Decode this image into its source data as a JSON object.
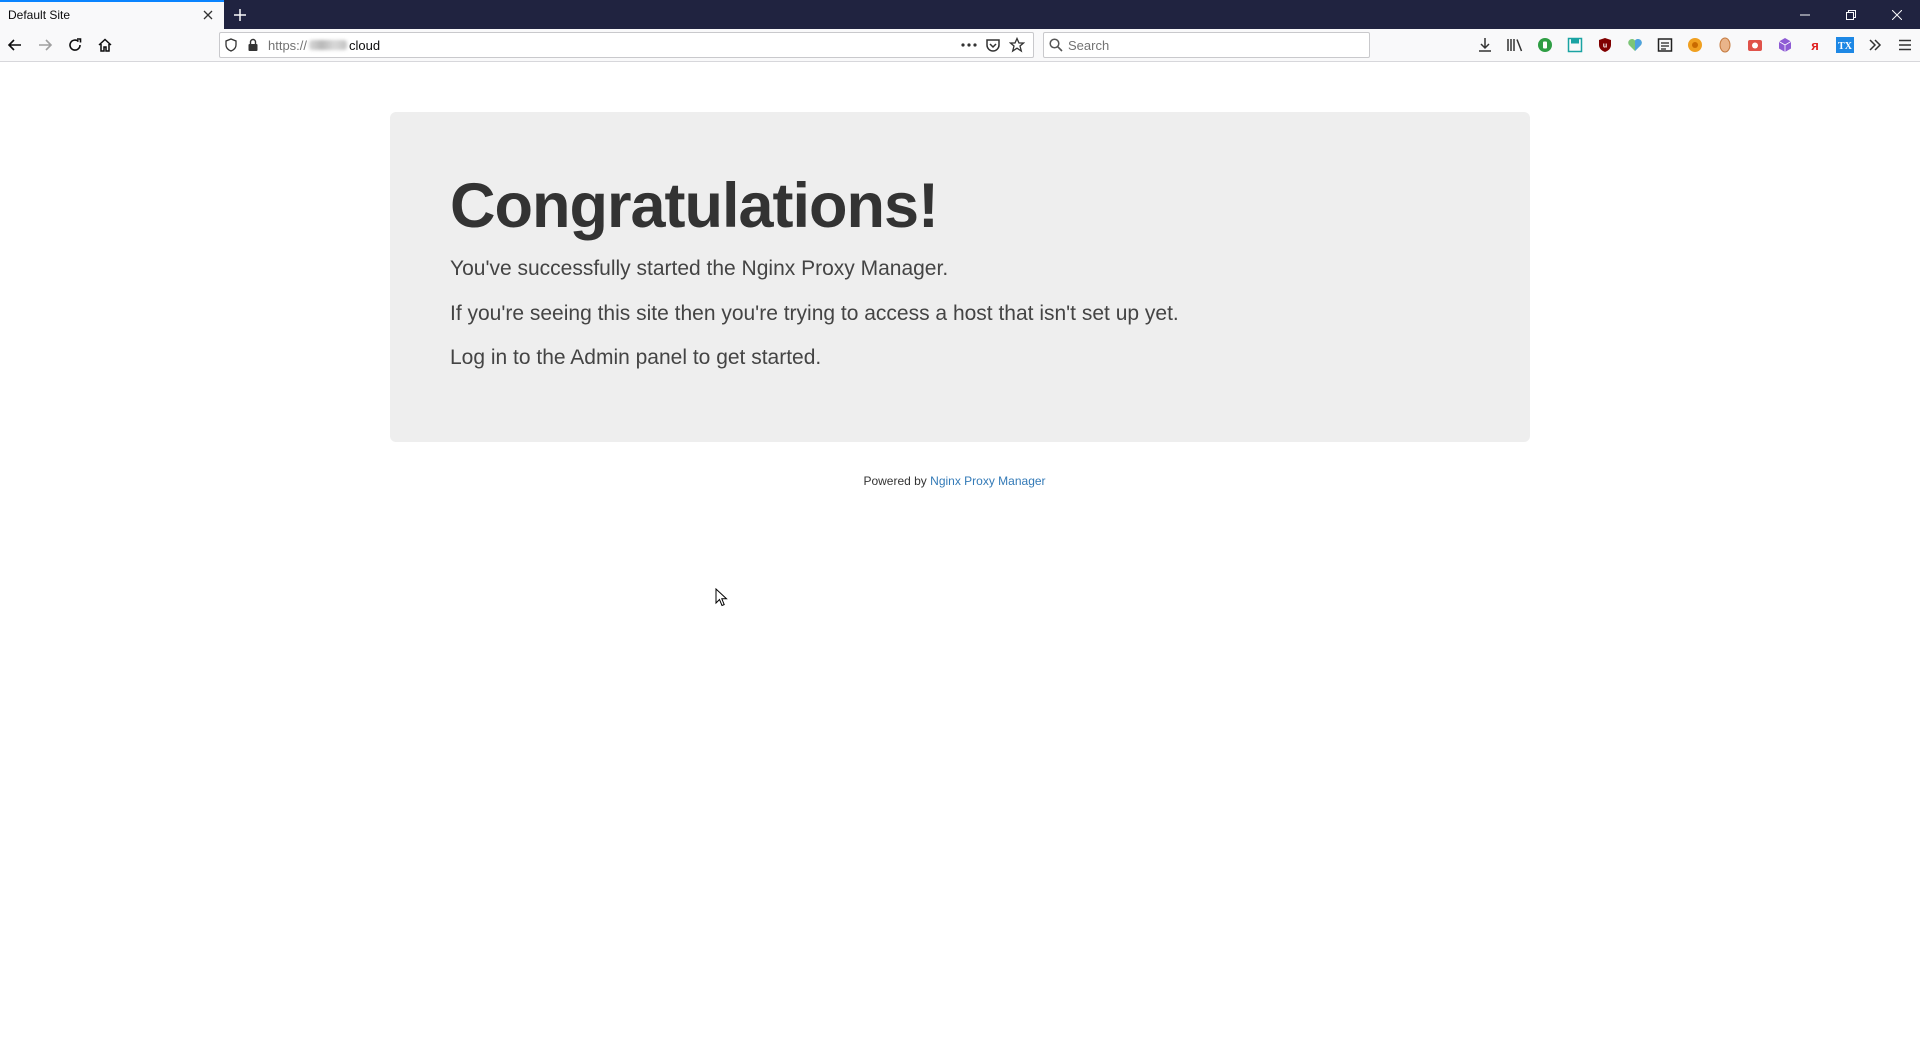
{
  "browser": {
    "tab": {
      "title": "Default Site"
    },
    "url": {
      "protocol": "https://",
      "domain": "cloud"
    },
    "search": {
      "placeholder": "Search"
    }
  },
  "page": {
    "heading": "Congratulations!",
    "paragraphs": [
      "You've successfully started the Nginx Proxy Manager.",
      "If you're seeing this site then you're trying to access a host that isn't set up yet.",
      "Log in to the Admin panel to get started."
    ],
    "footer": {
      "prefix": "Powered by",
      "link_text": "Nginx Proxy Manager"
    }
  },
  "colors": {
    "tabstrip_bg": "#202340",
    "tab_active_accent": "#0a84ff",
    "jumbotron_bg": "#eeeeee",
    "link": "#337ab7"
  },
  "icons": {
    "toolbar": [
      "download-icon",
      "library-icon",
      "green-circle-extension-icon",
      "save-extension-icon",
      "ublock-icon",
      "heart-extension-icon",
      "reader-extension-icon",
      "orange-extension-icon",
      "shield-extension-icon",
      "red-camera-extension-icon",
      "cube-extension-icon",
      "yandex-icon",
      "tx-extension-icon",
      "overflow-icon",
      "menu-icon"
    ]
  }
}
